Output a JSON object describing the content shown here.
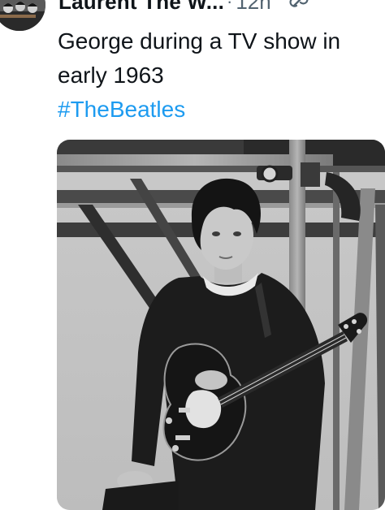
{
  "tweet": {
    "author_name": "Laurent The W...",
    "separator": "·",
    "time": "12h",
    "text": "George during a TV show in early 1963",
    "hashtag": "#TheBeatles"
  },
  "icons": {
    "avatar": "band-photo-avatar",
    "sync": "sync-icon",
    "more": "more-icon"
  },
  "media": {
    "description_type": "black-and-white photo"
  },
  "colors": {
    "text": "#0f1419",
    "secondary": "#536471",
    "link": "#1d9bf0"
  }
}
